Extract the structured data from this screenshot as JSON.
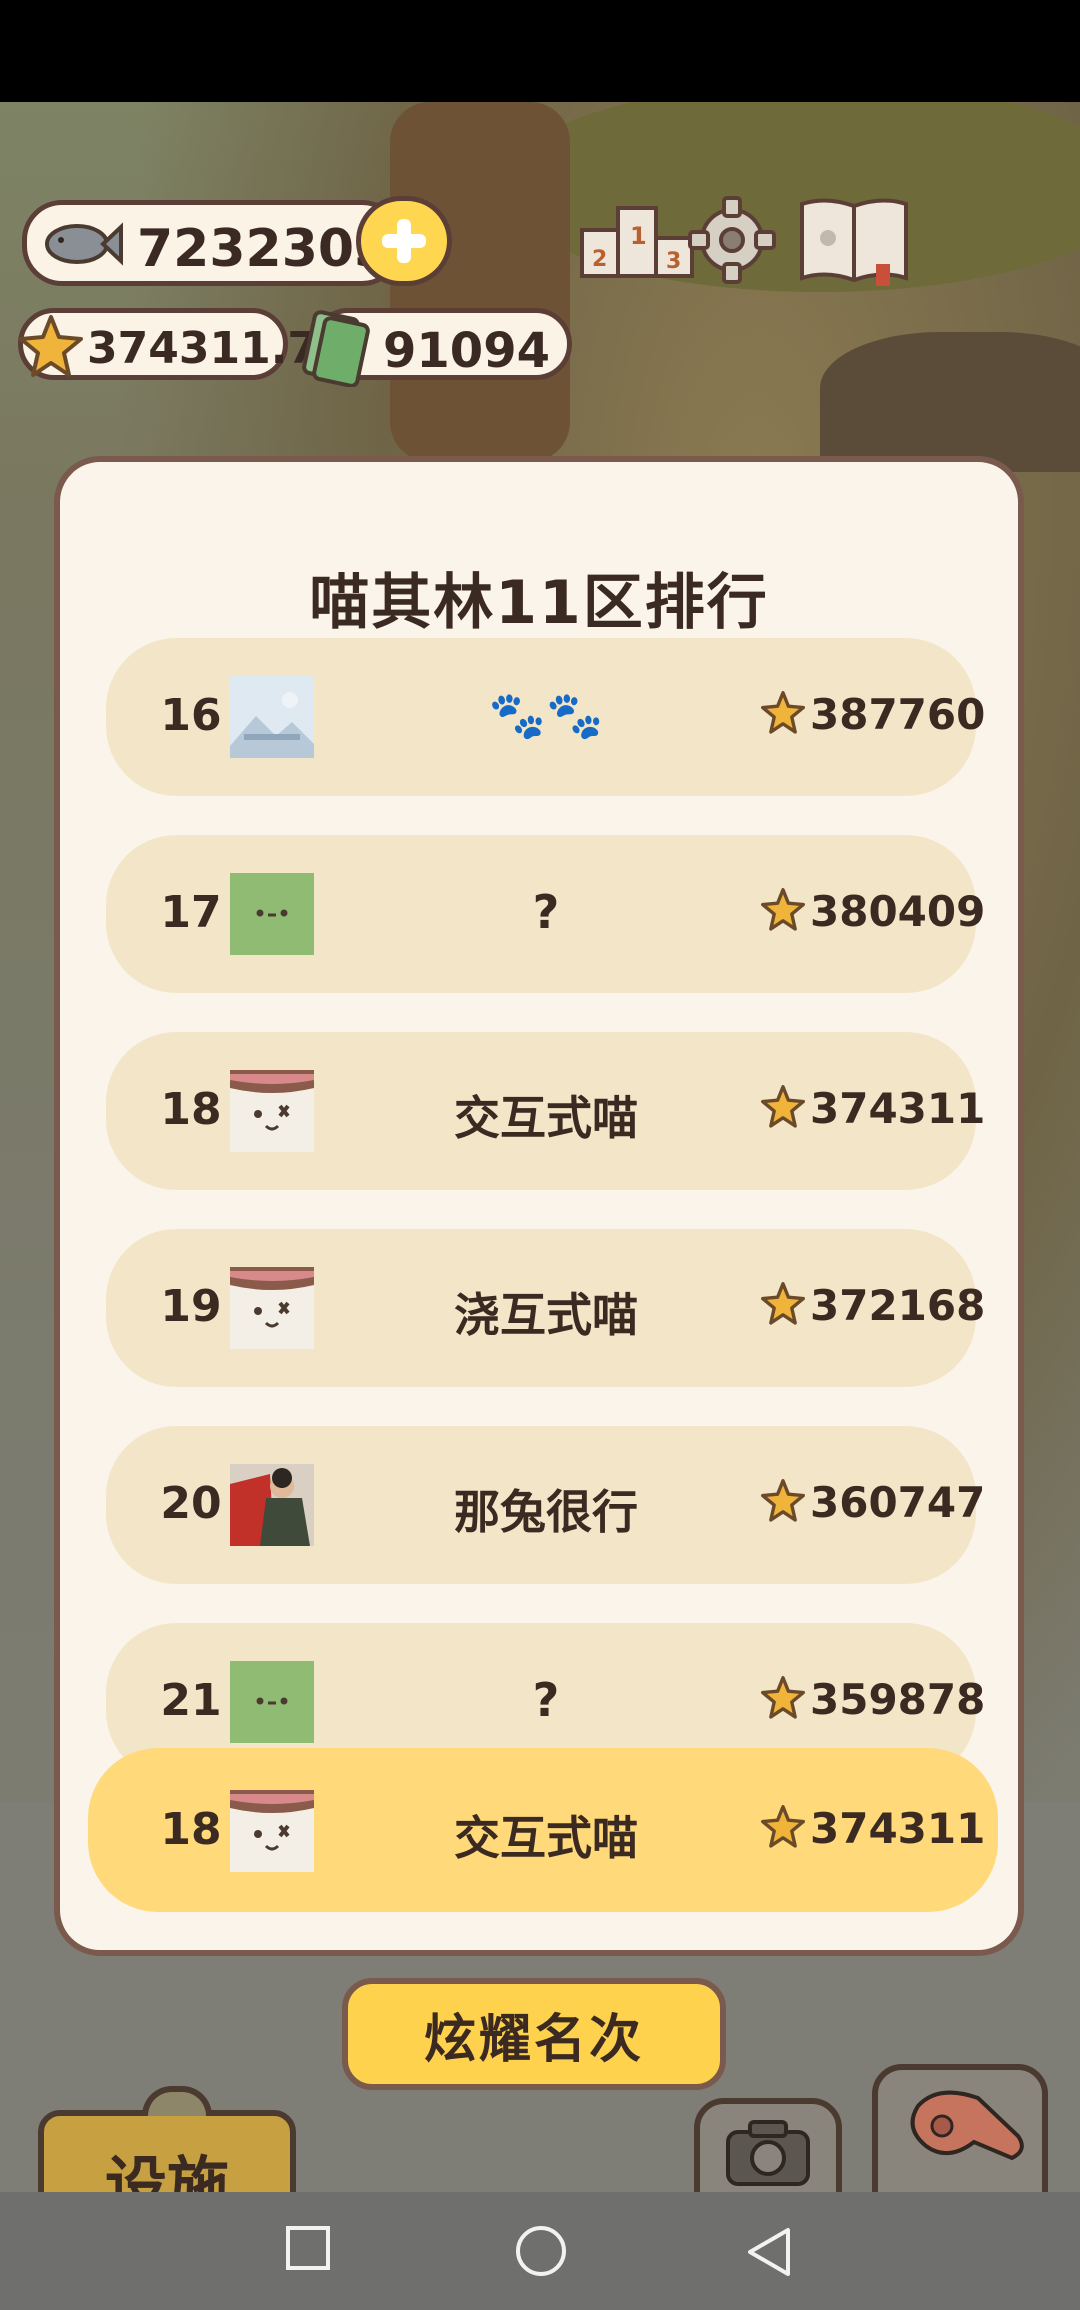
{
  "currency": {
    "fish": "7232303",
    "stars": "374311.7",
    "cash": "91094"
  },
  "panel": {
    "title": "喵其林11区排行"
  },
  "rankings": [
    {
      "rank": "16",
      "name": "🐾🐾",
      "score": "387760",
      "avatar": "placeholder-image"
    },
    {
      "rank": "17",
      "name": "?",
      "score": "380409",
      "avatar": "green-cat"
    },
    {
      "rank": "18",
      "name": "交互式喵",
      "score": "374311",
      "avatar": "white-cat"
    },
    {
      "rank": "19",
      "name": "浇互式喵",
      "score": "372168",
      "avatar": "white-cat"
    },
    {
      "rank": "20",
      "name": "那兔很行",
      "score": "360747",
      "avatar": "photo"
    },
    {
      "rank": "21",
      "name": "?",
      "score": "359878",
      "avatar": "green-cat"
    }
  ],
  "my_rank": {
    "rank": "18",
    "name": "交互式喵",
    "score": "374311",
    "avatar": "white-cat"
  },
  "buttons": {
    "show_rank": "炫耀名次",
    "facility": "设施",
    "photo": "照相",
    "gather": "集合"
  },
  "colors": {
    "panel_bg": "#fbf4ea",
    "row_bg": "#f3e6c8",
    "highlight_row": "#ffd97a",
    "button_yellow": "#ffd24d",
    "border_brown": "#7b5a4e"
  }
}
